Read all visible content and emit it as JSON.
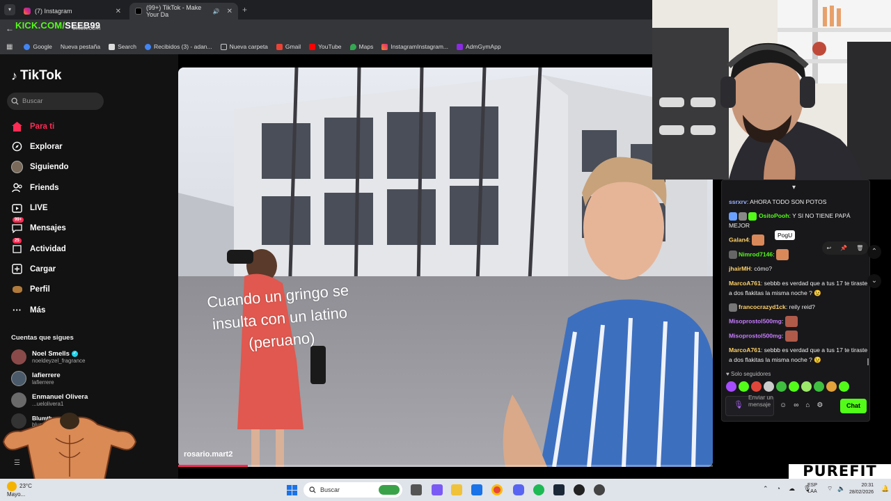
{
  "browser": {
    "tabs": [
      {
        "title": "(7) Instagram",
        "close": "✕"
      },
      {
        "title": "(99+) TikTok - Make Your Da",
        "close": "✕"
      }
    ],
    "new_tab": "+",
    "url": "tiktok.com",
    "bookmarks": [
      "Google",
      "Nueva pestaña",
      "Search",
      "Recibidos (3) - adan...",
      "Nueva carpeta",
      "Gmail",
      "YouTube",
      "Maps",
      "InstagramInstagram...",
      "AdmGymApp"
    ]
  },
  "overlay": {
    "kick_prefix": "KICK.COM/",
    "kick_user": "SEEB99",
    "purefit": "PUREFIT"
  },
  "tiktok": {
    "logo": "TikTok",
    "search_placeholder": "Buscar",
    "nav": [
      {
        "label": "Para ti",
        "icon": "home-icon"
      },
      {
        "label": "Explorar",
        "icon": "compass-icon"
      },
      {
        "label": "Siguiendo",
        "icon": "avatar-icon"
      },
      {
        "label": "Friends",
        "icon": "friends-icon"
      },
      {
        "label": "LIVE",
        "icon": "live-icon"
      },
      {
        "label": "Mensajes",
        "icon": "messages-icon",
        "badge": "99+"
      },
      {
        "label": "Actividad",
        "icon": "activity-icon",
        "badge": "25"
      },
      {
        "label": "Cargar",
        "icon": "upload-icon"
      },
      {
        "label": "Perfil",
        "icon": "profile-icon"
      },
      {
        "label": "Más",
        "icon": "more-icon"
      }
    ],
    "following_title": "Cuentas que sigues",
    "accounts": [
      {
        "name": "Noel Smells",
        "handle": "noeldeyzel_fragrance",
        "verified": true
      },
      {
        "name": "lafierrere",
        "handle": "lafierrere"
      },
      {
        "name": "Enmanuel Olivera",
        "handle": "...uelolivera1"
      },
      {
        "name": "Blumthew",
        "handle": "blumthew"
      }
    ]
  },
  "video": {
    "caption_lines": [
      "Cuando un gringo se",
      "insulta con un latino",
      "(peruano)"
    ],
    "author": "rosario.mart2",
    "progress": 0.13
  },
  "chat": {
    "messages": [
      {
        "user": "ssrxrv",
        "color": "#9ab0ff",
        "text": ": AHORA TODO SON POTOS"
      },
      {
        "user": "OsitoPooh",
        "color": "#53fc18",
        "text": ": Y SI NO TIENE PAPÁ MEJOR"
      },
      {
        "user": "Galan4",
        "color": "#ffd166",
        "text": ":"
      },
      {
        "user": "Nimrod7146",
        "color": "#53fc18",
        "text": ":"
      },
      {
        "user": "jhairMH",
        "color": "#ffd166",
        "text": ": cómo?"
      },
      {
        "user": "MarcoA761",
        "color": "#ffd166",
        "text": ": sebbb es verdad que a tus 17 te tiraste a dos flakitas la misma noche ? 😉"
      },
      {
        "user": "francocrazyd1ck",
        "color": "#ffd166",
        "text": ": reily reid?"
      },
      {
        "user": "Misoprostol500mg",
        "color": "#c77dff",
        "text": ":"
      },
      {
        "user": "Misoprostol500mg",
        "color": "#c77dff",
        "text": ":"
      },
      {
        "user": "MarcoA761",
        "color": "#ffd166",
        "text": ": sebbb es verdad que a tus 17 te tiraste a dos flakitas la misma noche ? 😉"
      }
    ],
    "tooltip": "PogU",
    "followers_only": "Solo seguidores",
    "input_placeholder": "Enviar un mensaje",
    "send_label": "Chat"
  },
  "taskbar": {
    "weather_temp": "23°C",
    "weather_desc": "Mayo...",
    "search_placeholder": "Buscar",
    "lang_top": "ESP",
    "lang_bottom": "LAA",
    "time": "20:31",
    "date": "28/02/2026"
  }
}
